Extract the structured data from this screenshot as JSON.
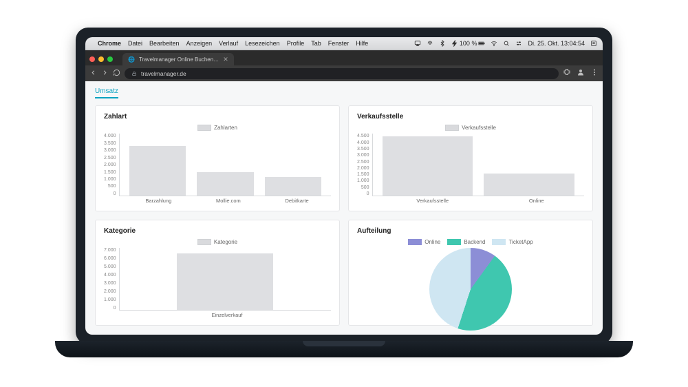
{
  "menubar": {
    "app": "Chrome",
    "items": [
      "Datei",
      "Bearbeiten",
      "Anzeigen",
      "Verlauf",
      "Lesezeichen",
      "Profile",
      "Tab",
      "Fenster",
      "Hilfe"
    ],
    "battery_pct": "100 %",
    "datetime": "Di. 25. Okt.  13:04:54"
  },
  "browser": {
    "tab_title": "Travelmanager Online Buchen…",
    "url": "travelmanager.de"
  },
  "page": {
    "active_tab": "Umsatz"
  },
  "chart_data": [
    {
      "id": "zahlart",
      "type": "bar",
      "title": "Zahlart",
      "legend": "Zahlarten",
      "categories": [
        "Barzahlung",
        "Mollie.com",
        "Debitkarte"
      ],
      "values": [
        3200,
        1500,
        1200
      ],
      "ylim": [
        0,
        4000
      ],
      "yticks": [
        0,
        500,
        1000,
        1500,
        2000,
        2500,
        3000,
        3500,
        4000
      ]
    },
    {
      "id": "verkaufsstelle",
      "type": "bar",
      "title": "Verkaufsstelle",
      "legend": "Verkaufsstelle",
      "categories": [
        "Verkaufsstelle",
        "Online"
      ],
      "values": [
        4300,
        1600
      ],
      "ylim": [
        0,
        4500
      ],
      "yticks": [
        0,
        500,
        1000,
        1500,
        2000,
        2500,
        3000,
        3500,
        4000,
        4500
      ]
    },
    {
      "id": "kategorie",
      "type": "bar",
      "title": "Kategorie",
      "legend": "Kategorie",
      "categories": [
        "Einzelverkauf"
      ],
      "values": [
        6400
      ],
      "ylim": [
        0,
        7000
      ],
      "yticks": [
        0,
        1000,
        2000,
        3000,
        4000,
        5000,
        6000,
        7000
      ]
    },
    {
      "id": "aufteilung",
      "type": "pie",
      "title": "Aufteilung",
      "series": [
        {
          "name": "Online",
          "value": 20,
          "color": "#8c8ed6"
        },
        {
          "name": "Backend",
          "value": 45,
          "color": "#3fc7af"
        },
        {
          "name": "TicketApp",
          "value": 35,
          "color": "#cfe6f2"
        }
      ]
    }
  ],
  "colors": {
    "traffic": {
      "close": "#ff5f57",
      "min": "#febc2e",
      "max": "#28c840"
    }
  }
}
